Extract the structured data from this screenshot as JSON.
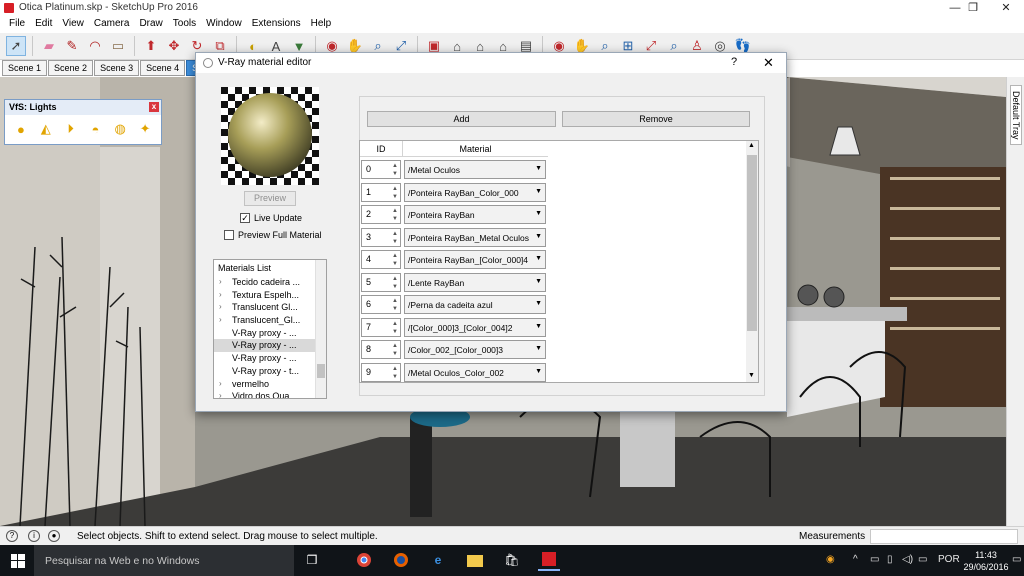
{
  "window": {
    "title": "Otica Platinum.skp - SketchUp Pro 2016",
    "minimize": "—",
    "maximize": "❐",
    "close": "✕"
  },
  "menu": [
    "File",
    "Edit",
    "View",
    "Camera",
    "Draw",
    "Tools",
    "Window",
    "Extensions",
    "Help"
  ],
  "toolbar": {
    "icons": [
      "select-icon",
      "eraser-icon",
      "pencil-icon",
      "arc-icon",
      "rectangle-icon",
      "push-pull-icon",
      "move-icon",
      "rotate-icon",
      "offset-icon",
      "tape-icon",
      "text-icon",
      "paint-icon",
      "orbit-icon",
      "pan-icon",
      "zoom-icon",
      "zoom-extents-icon",
      "components-icon",
      "views-icon",
      "walk-icon",
      "look-around-icon",
      "section-icon"
    ]
  },
  "scenes": [
    "Scene 1",
    "Scene 2",
    "Scene 3",
    "Scene 4",
    "Scene 5"
  ],
  "scene_active": 4,
  "tray": {
    "label": "Default Tray"
  },
  "lights_panel": {
    "title": "VfS: Lights",
    "close": "x",
    "icons": [
      "omni-light-icon",
      "spot-light-icon",
      "directional-light-icon",
      "dome-light-icon",
      "sphere-light-icon",
      "ies-light-icon"
    ]
  },
  "dialog": {
    "title": "V-Ray material editor",
    "help": "?",
    "close": "✕",
    "preview_button": "Preview",
    "live_update": {
      "label": "Live Update",
      "checked": true
    },
    "preview_full": {
      "label": "Preview Full Material",
      "checked": false
    },
    "materials_list": {
      "header": "Materials List",
      "items": [
        "Tecido cadeira ...",
        "Textura Espelh...",
        "Translucent Gl...",
        "Translucent_Gl...",
        "V-Ray proxy - ...",
        "V-Ray proxy - ...",
        "V-Ray proxy - ...",
        "V-Ray proxy - t...",
        "vermelho",
        "Vidro dos Qua..."
      ],
      "selected_index": 5,
      "expandable": [
        true,
        true,
        true,
        true,
        false,
        false,
        false,
        false,
        true,
        true
      ]
    },
    "add_button": "Add",
    "remove_button": "Remove",
    "table": {
      "headers": {
        "id": "ID",
        "material": "Material"
      },
      "rows": [
        {
          "id": "0",
          "material": "/Metal Oculos"
        },
        {
          "id": "1",
          "material": "/Ponteira RayBan_Color_000"
        },
        {
          "id": "2",
          "material": "/Ponteira RayBan"
        },
        {
          "id": "3",
          "material": "/Ponteira RayBan_Metal Oculos"
        },
        {
          "id": "4",
          "material": "/Ponteira RayBan_[Color_000]4"
        },
        {
          "id": "5",
          "material": "/Lente RayBan"
        },
        {
          "id": "6",
          "material": "/Perna da cadeita azul"
        },
        {
          "id": "7",
          "material": "/[Color_000]3_[Color_004]2"
        },
        {
          "id": "8",
          "material": "/Color_002_[Color_000]3"
        },
        {
          "id": "9",
          "material": "/Metal Oculos_Color_002"
        }
      ]
    }
  },
  "statusbar": {
    "message": "Select objects. Shift to extend select. Drag mouse to select multiple.",
    "measurements_label": "Measurements"
  },
  "taskbar": {
    "search_placeholder": "Pesquisar na Web e no Windows",
    "apps": [
      "task-view-icon",
      "chrome-icon",
      "firefox-icon",
      "edge-icon",
      "file-explorer-icon",
      "store-icon",
      "sketchup-icon"
    ],
    "language": "POR",
    "time": "11:43",
    "date": "29/06/2016"
  },
  "colors": {
    "scene_active": "#3d8fde",
    "taskbar": "#101418",
    "dialog_bg": "#f0f0f0"
  }
}
